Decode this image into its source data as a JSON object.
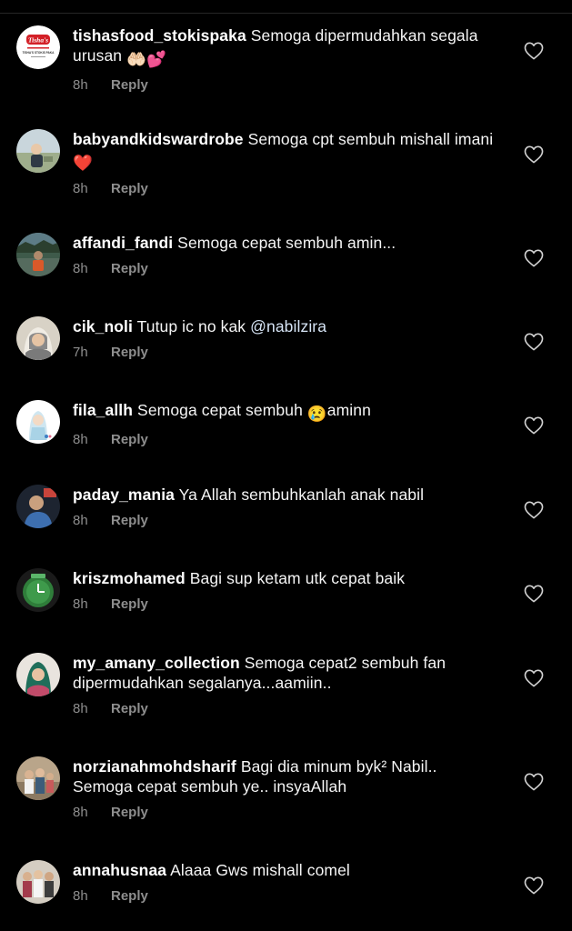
{
  "comments": [
    {
      "username": "tishasfood_stokispaka",
      "text": "Semoga dipermudahkan segala urusan",
      "emoji": "🤲🏻💕",
      "time": "8h",
      "reply_label": "Reply",
      "avatar_icon": "tishas-logo-avatar",
      "avatar_logo_text": "Tisha's",
      "avatar_sub_text": "TISHA'S STOKIS PAKA"
    },
    {
      "username": "babyandkidswardrobe",
      "text": "Semoga cpt sembuh mishall imani",
      "emoji": "❤️",
      "time": "8h",
      "reply_label": "Reply",
      "avatar_icon": "child-outdoor-avatar"
    },
    {
      "username": "affandi_fandi",
      "text": "Semoga cepat sembuh amin...",
      "time": "8h",
      "reply_label": "Reply",
      "avatar_icon": "lake-person-avatar"
    },
    {
      "username": "cik_noli",
      "text": "Tutup ic no kak",
      "mention": "@nabilzira",
      "time": "7h",
      "reply_label": "Reply",
      "avatar_icon": "hijab-woman-avatar"
    },
    {
      "username": "fila_allh",
      "text": "Semoga cepat sembuh",
      "emoji": "😢",
      "text_after": "aminn",
      "time": "8h",
      "reply_label": "Reply",
      "avatar_icon": "cartoon-hijab-avatar"
    },
    {
      "username": "paday_mania",
      "text": "Ya Allah sembuhkanlah anak nabil",
      "time": "8h",
      "reply_label": "Reply",
      "avatar_icon": "man-blue-shirt-avatar"
    },
    {
      "username": "kriszmohamed",
      "text": "Bagi sup ketam utk cepat baik",
      "time": "8h",
      "reply_label": "Reply",
      "avatar_icon": "green-clock-avatar"
    },
    {
      "username": "my_amany_collection",
      "text": "Semoga cepat2 sembuh fan dipermudahkan segalanya...aamiin..",
      "time": "8h",
      "reply_label": "Reply",
      "avatar_icon": "green-hijab-avatar"
    },
    {
      "username": "norzianahmohdsharif",
      "text": "Bagi dia minum byk² Nabil.. Semoga cepat sembuh ye.. insyaAllah",
      "time": "8h",
      "reply_label": "Reply",
      "avatar_icon": "family-photo-avatar"
    },
    {
      "username": "annahusnaa",
      "text": "Alaaa Gws mishall comel",
      "time": "8h",
      "reply_label": "Reply",
      "avatar_icon": "group-photo-avatar"
    }
  ],
  "like_icon": "heart-outline-icon",
  "colors": {
    "background": "#000000",
    "text": "#f5f5f5",
    "secondary": "#8e8e8e",
    "mention": "#d6e4f5",
    "divider": "#262626"
  }
}
